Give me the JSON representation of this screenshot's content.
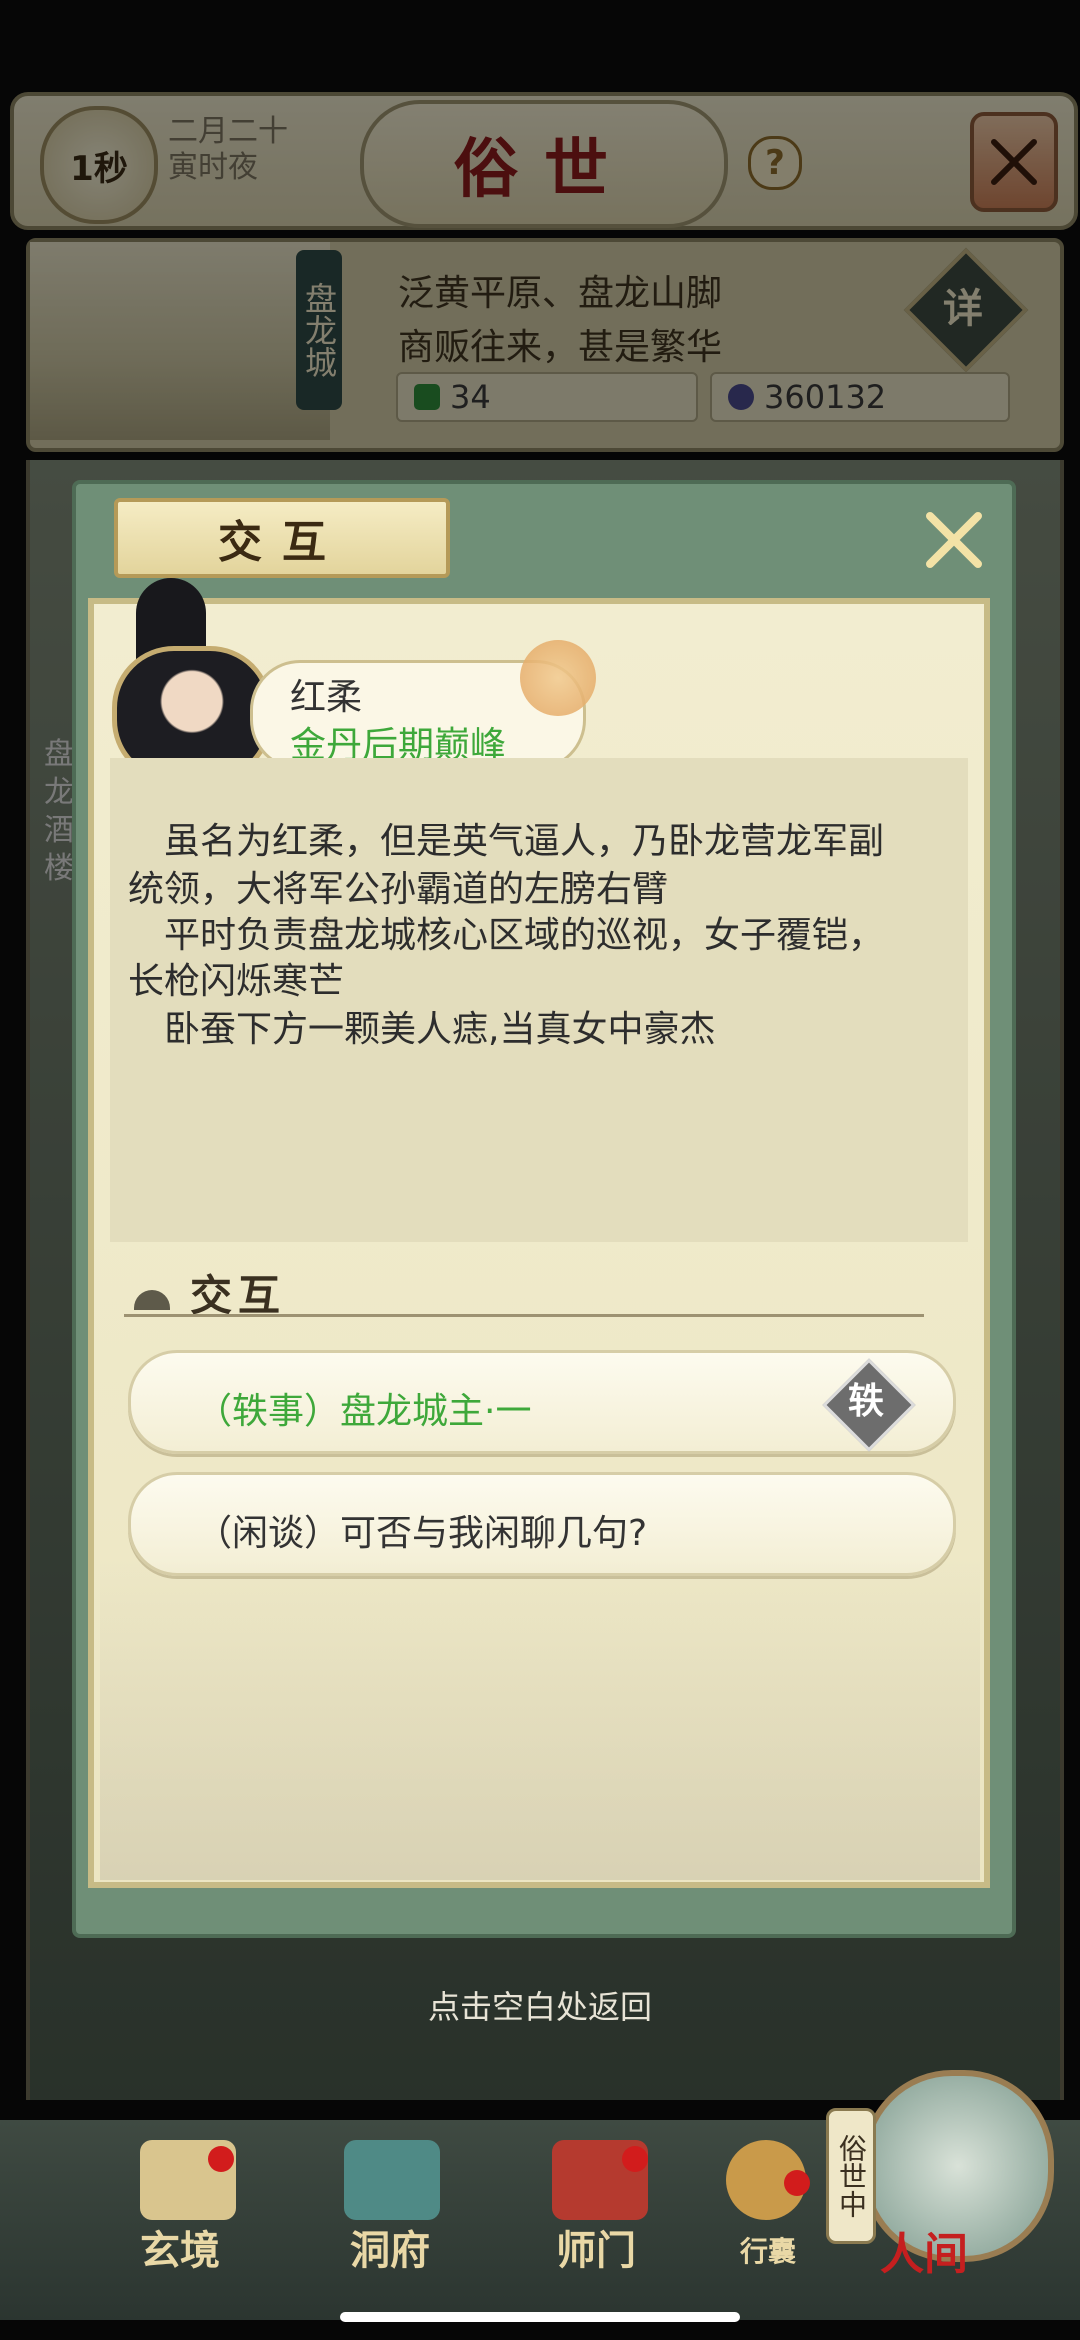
{
  "header": {
    "timer": "1秒",
    "date_line1": "二月二十",
    "date_line2": "寅时夜",
    "title": "俗世",
    "help": "?"
  },
  "location": {
    "city": "盘龙城",
    "line1": "泛黄平原、盘龙山脚",
    "line2": "商贩往来，甚是繁华",
    "detail": "详",
    "resource1": "34",
    "resource2": "360132",
    "resource1_color": "#2f8a3a",
    "resource2_color": "#4a4a8a"
  },
  "dialog": {
    "tab_title": "交互",
    "npc_name": "红柔",
    "npc_realm": "金丹后期巅峰",
    "description": [
      "虽名为红柔，但是英气逼人，乃卧龙营龙军副",
      "统领，大将军公孙霸道的左膀右臂",
      "平时负责盘龙城核心区域的巡视，女子覆铠，",
      "长枪闪烁寒芒",
      "卧蚕下方一颗美人痣,当真女中豪杰"
    ],
    "section_title": "交互",
    "options": [
      {
        "label": "（轶事）盘龙城主·一",
        "badge": "轶",
        "color": "#3ea83a"
      },
      {
        "label": "（闲谈）可否与我闲聊几句?",
        "color": "#333333"
      }
    ],
    "return_hint": "点击空白处返回"
  },
  "nav": {
    "items": [
      "玄境",
      "洞府",
      "师门",
      "行囊"
    ],
    "human": "人间",
    "status": "俗世中"
  },
  "side_label": "盘龙酒楼"
}
